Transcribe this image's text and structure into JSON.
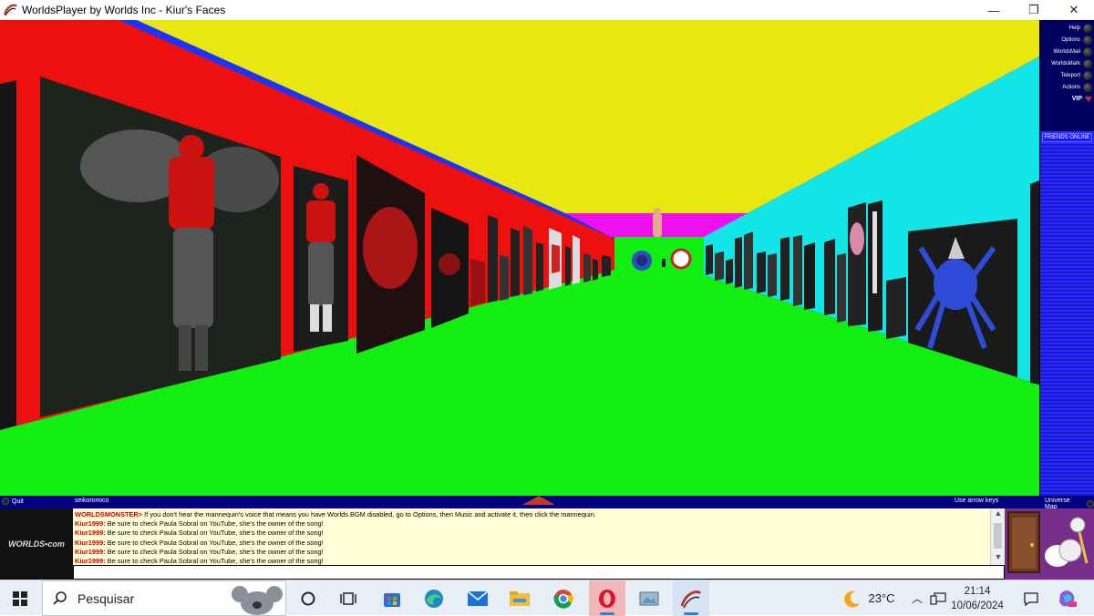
{
  "window": {
    "title": "WorldsPlayer by Worlds Inc - Kiur's Faces",
    "minimize_glyph": "—",
    "restore_glyph": "❐",
    "close_glyph": "✕"
  },
  "side_menu": {
    "items": [
      {
        "label": "Help"
      },
      {
        "label": "Options"
      },
      {
        "label": "WorldsMail"
      },
      {
        "label": "WorldsMark"
      },
      {
        "label": "Teleport"
      },
      {
        "label": "Actions"
      },
      {
        "label": "VIP"
      }
    ],
    "friends_online": "FRIENDS ONLINE"
  },
  "status_bar": {
    "quit": "Quit",
    "username": "seikoromico",
    "hint": "Use arrow keys",
    "universe_map": "Universe Map"
  },
  "logo": {
    "text": "WORLDS•com"
  },
  "chat": {
    "lines": [
      {
        "who": "WORLDSMONSTER>",
        "text": " If you don't hear the mannequin's voice that means you have Worlds BGM disabled, go to Options, then Music and activate it, then click the mannequin."
      },
      {
        "who": "Kiur1999:",
        "text": " Be sure to check Paula Sobral on YouTube, she's the owner of the song!"
      },
      {
        "who": "Kiur1999:",
        "text": " Be sure to check Paula Sobral on YouTube, she's the owner of the song!"
      },
      {
        "who": "Kiur1999:",
        "text": " Be sure to check Paula Sobral on YouTube, she's the owner of the song!"
      },
      {
        "who": "Kiur1999:",
        "text": " Be sure to check Paula Sobral on YouTube, she's the owner of the song!"
      },
      {
        "who": "Kiur1999:",
        "text": " Be sure to check Paula Sobral on YouTube, she's the owner of the song!"
      }
    ],
    "input_value": ""
  },
  "taskbar": {
    "search_label": "Pesquisar",
    "temperature": "23°C",
    "time": "21:14",
    "date": "10/06/2024",
    "apps": [
      "cortana-icon",
      "task-view-icon",
      "store-icon",
      "edge-icon",
      "mail-icon",
      "explorer-icon",
      "chrome-icon",
      "opera-icon",
      "photos-icon",
      "worlds-icon"
    ]
  },
  "colors": {
    "left_wall": "#ee0f0f",
    "ceiling": "#e8e810",
    "floor": "#11ee11",
    "right_wall": "#12e5e5",
    "sky": "#1a33ff",
    "back_wall_top": "#ee11ee"
  }
}
